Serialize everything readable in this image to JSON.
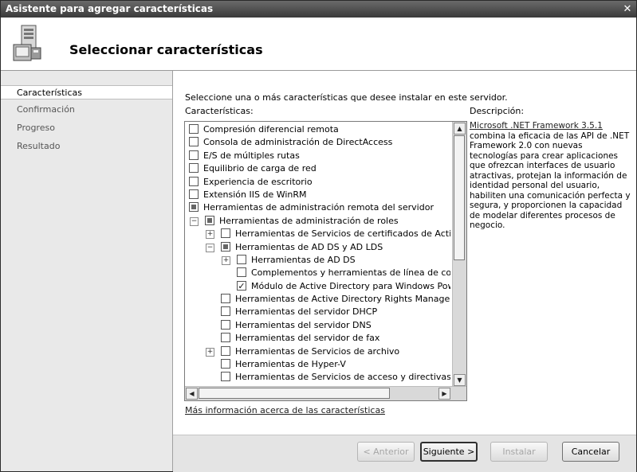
{
  "window": {
    "title": "Asistente para agregar características",
    "close_glyph": "✕"
  },
  "header": {
    "title": "Seleccionar características",
    "icon": "server-features-icon"
  },
  "sidebar": {
    "items": [
      {
        "label": "Características",
        "active": true
      },
      {
        "label": "Confirmación",
        "active": false
      },
      {
        "label": "Progreso",
        "active": false
      },
      {
        "label": "Resultado",
        "active": false
      }
    ]
  },
  "main": {
    "instruction": "Seleccione una o más características que desee instalar en este servidor.",
    "features_label": "Características:",
    "description_label": "Descripción:",
    "description_link": "Microsoft .NET Framework 3.5.1",
    "description_text": "combina la eficacia de las API de .NET Framework 2.0 con nuevas tecnologías para crear aplicaciones que ofrezcan interfaces de usuario atractivas, protejan la información de identidad personal del usuario, habiliten una comunicación perfecta y segura, y proporcionen la capacidad de modelar diferentes procesos de negocio.",
    "more_info_link": "Más información acerca de las características",
    "tree": [
      {
        "label": "Compresión diferencial remota",
        "level": 0,
        "expander": "",
        "check": "unchecked"
      },
      {
        "label": "Consola de administración de DirectAccess",
        "level": 0,
        "expander": "",
        "check": "unchecked"
      },
      {
        "label": "E/S de múltiples rutas",
        "level": 0,
        "expander": "",
        "check": "unchecked"
      },
      {
        "label": "Equilibrio de carga de red",
        "level": 0,
        "expander": "",
        "check": "unchecked"
      },
      {
        "label": "Experiencia de escritorio",
        "level": 0,
        "expander": "",
        "check": "unchecked"
      },
      {
        "label": "Extensión IIS de WinRM",
        "level": 0,
        "expander": "",
        "check": "unchecked"
      },
      {
        "label": "Herramientas de administración remota del servidor",
        "level": 0,
        "expander": "",
        "check": "partial"
      },
      {
        "label": "Herramientas de administración de roles",
        "level": 1,
        "expander": "−",
        "check": "partial"
      },
      {
        "label": "Herramientas de Servicios de certificados de Active Di",
        "level": 2,
        "expander": "+",
        "check": "unchecked"
      },
      {
        "label": "Herramientas de AD DS y AD LDS",
        "level": 2,
        "expander": "−",
        "check": "partial"
      },
      {
        "label": "Herramientas de AD DS",
        "level": 3,
        "expander": "+",
        "check": "unchecked"
      },
      {
        "label": "Complementos y herramientas de línea de comanc",
        "level": 3,
        "expander": "",
        "check": "unchecked"
      },
      {
        "label": "Módulo de Active Directory para Windows PowerS",
        "level": 3,
        "expander": "",
        "check": "checked"
      },
      {
        "label": "Herramientas de Active Directory Rights Management",
        "level": 2,
        "expander": "",
        "check": "unchecked"
      },
      {
        "label": "Herramientas del servidor DHCP",
        "level": 2,
        "expander": "",
        "check": "unchecked"
      },
      {
        "label": "Herramientas del servidor DNS",
        "level": 2,
        "expander": "",
        "check": "unchecked"
      },
      {
        "label": "Herramientas del servidor de fax",
        "level": 2,
        "expander": "",
        "check": "unchecked"
      },
      {
        "label": "Herramientas de Servicios de archivo",
        "level": 2,
        "expander": "+",
        "check": "unchecked"
      },
      {
        "label": "Herramientas de Hyper-V",
        "level": 2,
        "expander": "",
        "check": "unchecked"
      },
      {
        "label": "Herramientas de Servicios de acceso y directivas de r",
        "level": 2,
        "expander": "",
        "check": "unchecked"
      }
    ]
  },
  "footer": {
    "prev_label": "< Anterior",
    "next_label": "Siguiente >",
    "install_label": "Instalar",
    "cancel_label": "Cancelar"
  },
  "colors": {
    "titlebar": "#4a4a4a",
    "sidebar": "#e9e9e9",
    "footer": "#e4e4e4"
  }
}
